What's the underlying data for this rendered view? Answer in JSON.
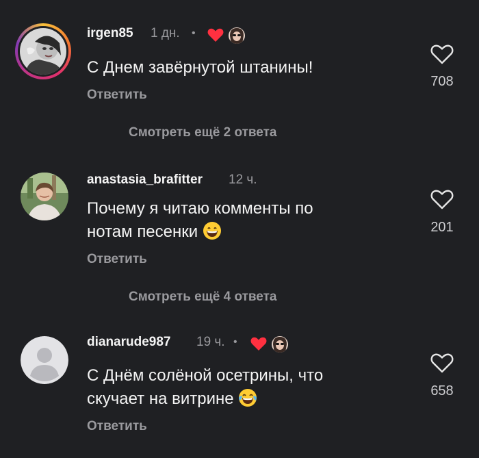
{
  "comments": [
    {
      "username": "irgen85",
      "time": "1 дн.",
      "separator": "•",
      "liked_by_author": true,
      "text": "С Днем завёрнутой штанины!",
      "reply_label": "Ответить",
      "likes": "708",
      "avatar": "woman-photo-avatar",
      "has_story_ring": true
    },
    {
      "username": "anastasia_brafitter",
      "time": "12 ч.",
      "liked_by_author": false,
      "text_line1": "Почему я читаю комменты по",
      "text_line2": "нотам песенки",
      "emoji": "grinning-face-emoji",
      "reply_label": "Ответить",
      "likes": "201",
      "avatar": "woman-outdoor-photo-avatar"
    },
    {
      "username": "dianarude987",
      "time": "19 ч.",
      "separator": "•",
      "liked_by_author": true,
      "text_line1": "С Днём солёной осетрины, что",
      "text_line2": "скучает на витрине",
      "emoji": "tears-of-joy-emoji",
      "reply_label": "Ответить",
      "likes": "658",
      "avatar": "default-avatar"
    }
  ],
  "view_more": [
    "Смотреть ещё 2 ответа",
    "Смотреть ещё 4 ответа"
  ],
  "colors": {
    "background": "#1f2023",
    "primary_text": "#f4f4f4",
    "secondary_text": "#9a9a9e",
    "heart_red": "#ff3040"
  }
}
